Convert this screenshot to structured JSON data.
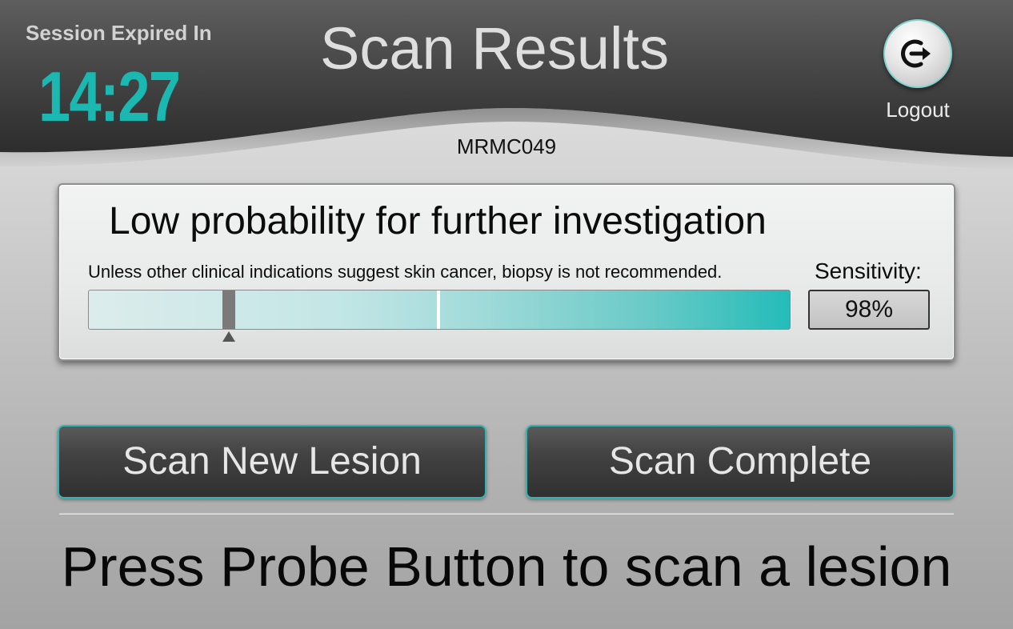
{
  "header": {
    "session_label": "Session Expired In",
    "session_timer": "14:27",
    "title": "Scan Results",
    "logout_label": "Logout",
    "patient_id": "MRMC049"
  },
  "result": {
    "headline": "Low probability for further investigation",
    "note": "Unless other clinical indications suggest skin cancer, biopsy is not recommended.",
    "sensitivity_label": "Sensitivity:",
    "sensitivity_value": "98%",
    "probability_score": 0.2
  },
  "actions": {
    "scan_new_label": "Scan New Lesion",
    "scan_complete_label": "Scan Complete"
  },
  "footer": {
    "instruction": "Press Probe Button to scan a lesion"
  },
  "colors": {
    "accent": "#1ab8b0",
    "header_dark": "#3a3a3a",
    "button_dark": "#3a3a3a"
  },
  "icons": {
    "logout": "logout-icon"
  }
}
